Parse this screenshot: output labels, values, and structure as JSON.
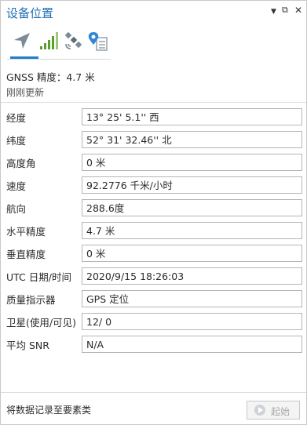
{
  "pane": {
    "title": "设备位置",
    "controls": {
      "menu": "▼",
      "dock": "⧉",
      "close": "✕"
    }
  },
  "tabs": [
    {
      "icon": "location-arrow-icon",
      "selected": true
    },
    {
      "icon": "signal-bars-icon",
      "selected": false
    },
    {
      "icon": "satellite-icon",
      "selected": false
    },
    {
      "icon": "location-log-icon",
      "selected": false
    }
  ],
  "status": {
    "gnss": "GNSS 精度：4.7 米",
    "updated": "刚刚更新"
  },
  "fields": [
    {
      "label": "经度",
      "value": "13° 25' 5.1'' 西"
    },
    {
      "label": "纬度",
      "value": "52° 31' 32.46'' 北"
    },
    {
      "label": "高度角",
      "value": "0 米"
    },
    {
      "label": "速度",
      "value": "92.2776 千米/小时"
    },
    {
      "label": "航向",
      "value": "288.6度"
    },
    {
      "label": "水平精度",
      "value": "4.7 米"
    },
    {
      "label": "垂直精度",
      "value": "0 米"
    },
    {
      "label": "UTC 日期/时间",
      "value": "2020/9/15  18:26:03"
    },
    {
      "label": "质量指示器",
      "value": "GPS 定位"
    },
    {
      "label": "卫星(使用/可见)",
      "value": "12/ 0"
    },
    {
      "label": "平均 SNR",
      "value": "N/A"
    }
  ],
  "footer": {
    "log_label": "将数据记录至要素类",
    "start_label": "起始"
  },
  "colors": {
    "accent": "#1f7fcf",
    "title": "#1f6fb5"
  }
}
